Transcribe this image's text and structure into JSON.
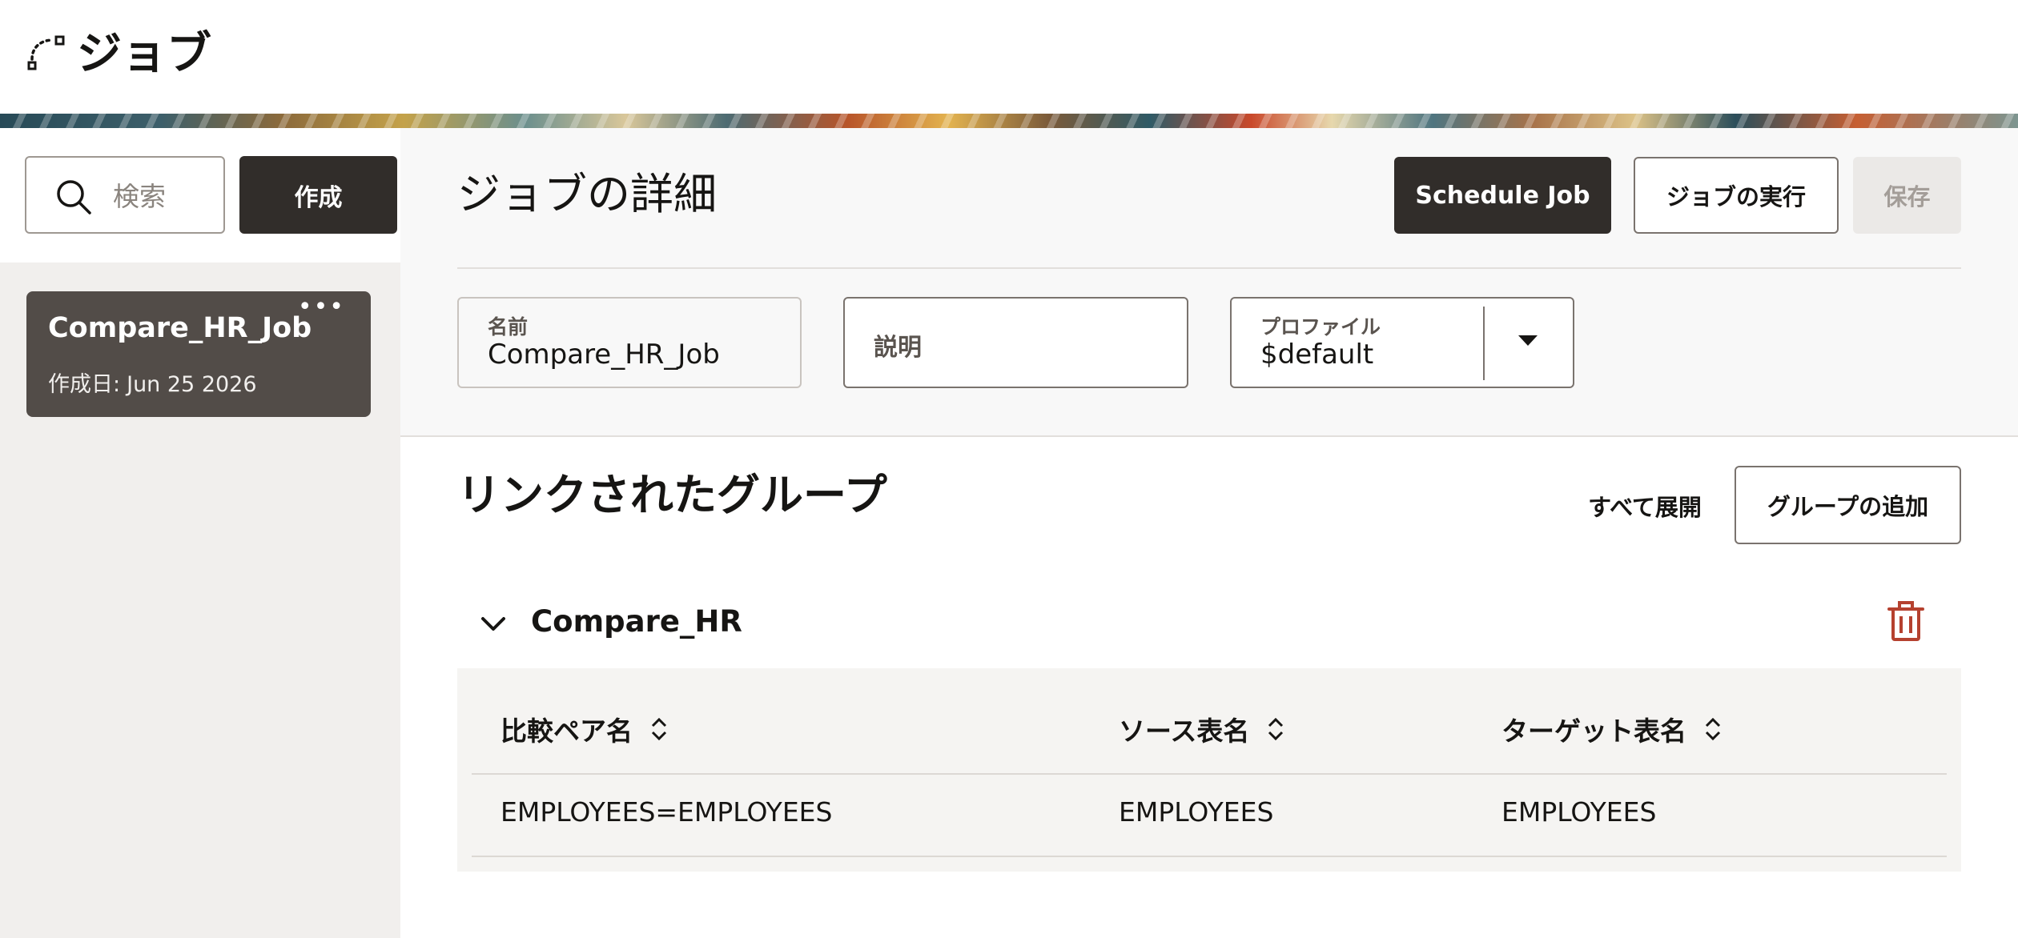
{
  "header": {
    "title": "ジョブ",
    "icon": "workflow-icon"
  },
  "sidebar": {
    "search": {
      "placeholder": "検索"
    },
    "create_label": "作成",
    "jobs": [
      {
        "name": "Compare_HR_Job",
        "created_label": "作成日:",
        "created_date": "Jun 25 2026",
        "menu": "•••"
      }
    ]
  },
  "details": {
    "title": "ジョブの詳細",
    "schedule_label": "Schedule Job",
    "run_label": "ジョブの実行",
    "save_label": "保存",
    "fields": {
      "name": {
        "label": "名前",
        "value": "Compare_HR_Job"
      },
      "description": {
        "placeholder": "説明"
      },
      "profile": {
        "label": "プロファイル",
        "value": "$default"
      }
    }
  },
  "groups": {
    "title": "リンクされたグループ",
    "expand_all_label": "すべて展開",
    "add_group_label": "グループの追加",
    "items": [
      {
        "name": "Compare_HR",
        "columns": [
          "比較ペア名",
          "ソース表名",
          "ターゲット表名"
        ],
        "rows": [
          [
            "EMPLOYEES=EMPLOYEES",
            "EMPLOYEES",
            "EMPLOYEES"
          ]
        ]
      }
    ]
  },
  "colors": {
    "primary_button": "#312d2a",
    "danger": "#b5412f",
    "sidebar_bg": "#f1efed"
  }
}
